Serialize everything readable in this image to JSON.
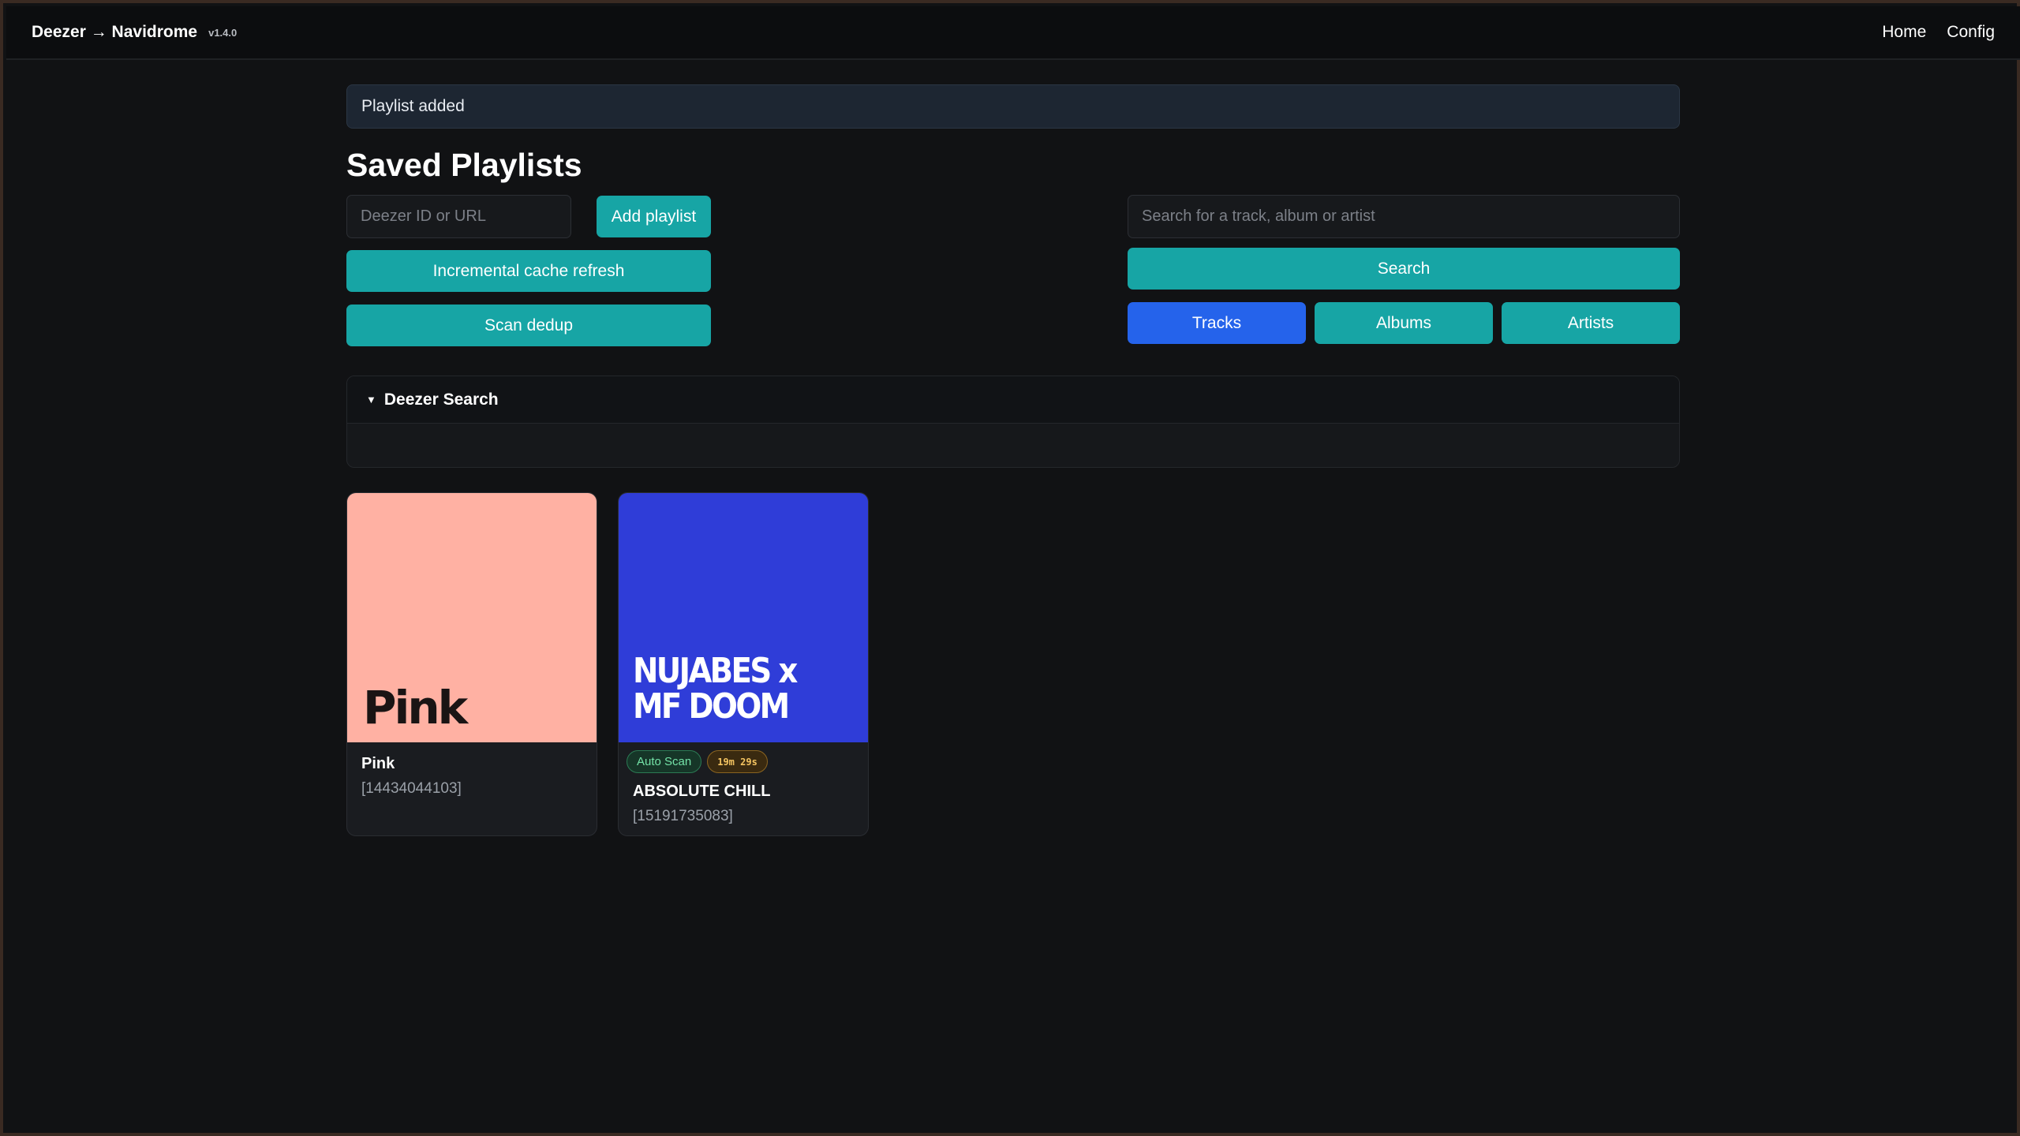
{
  "navbar": {
    "brand": "Deezer → Navidrome",
    "version": "v1.4.0",
    "links": {
      "home": "Home",
      "config": "Config"
    }
  },
  "alert": {
    "message": "Playlist added"
  },
  "page": {
    "title": "Saved Playlists"
  },
  "add_form": {
    "id_placeholder": "Deezer ID or URL",
    "add_label": "Add playlist",
    "refresh_label": "Incremental cache refresh",
    "dedup_label": "Scan dedup"
  },
  "search": {
    "placeholder": "Search for a track, album or artist",
    "button_label": "Search",
    "types": [
      {
        "label": "Tracks",
        "active": true
      },
      {
        "label": "Albums",
        "active": false
      },
      {
        "label": "Artists",
        "active": false
      }
    ]
  },
  "deezer_search": {
    "title": "Deezer Search",
    "caret": "▼"
  },
  "playlists": [
    {
      "cover_text": "Pink",
      "cover_color": "#ffb1a3",
      "title": "Pink",
      "id": "[14434044103]",
      "badges": []
    },
    {
      "cover_text": "NUJABES x MF DOOM",
      "cover_color": "#2f3dd8",
      "title": "ABSOLUTE CHILL",
      "id": "[15191735083]",
      "badges": [
        "Auto Scan",
        "19m 29s"
      ]
    }
  ],
  "colors": {
    "accent": "#17a5a5",
    "active": "#2563eb",
    "background": "#111214"
  }
}
